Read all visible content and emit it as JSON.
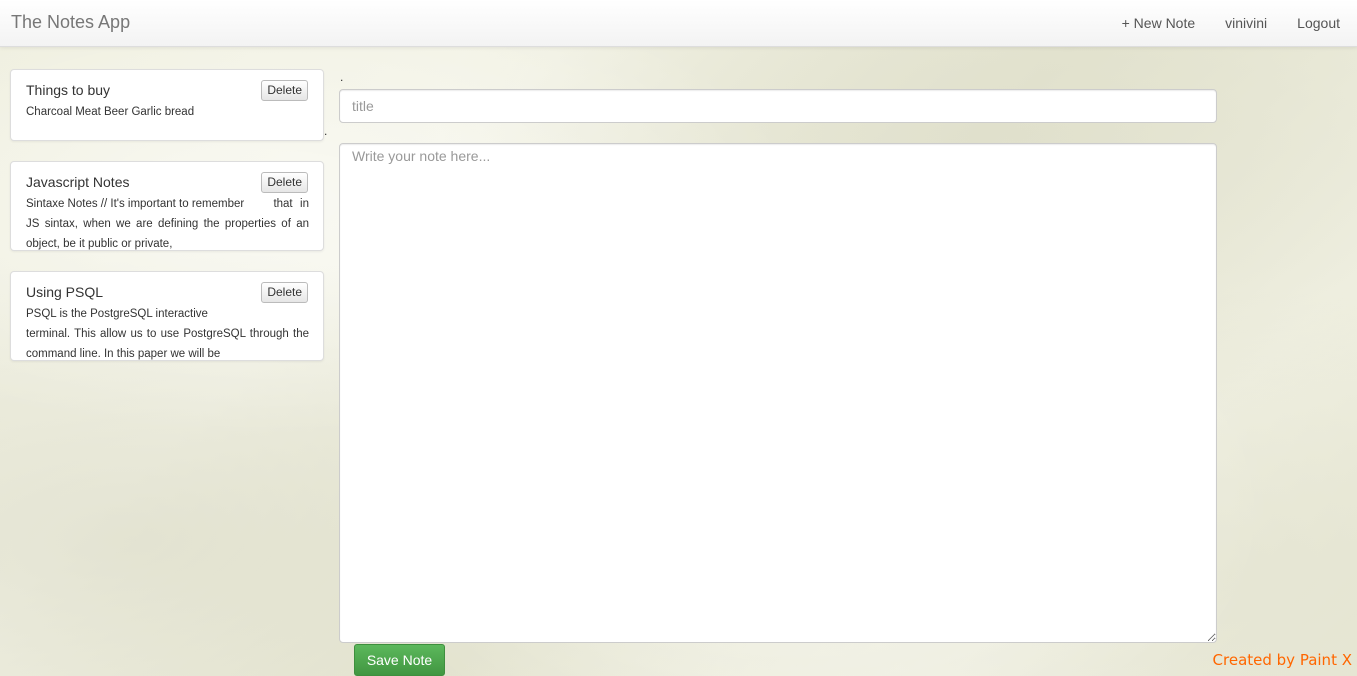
{
  "navbar": {
    "brand": "The Notes App",
    "new_note": "+ New Note",
    "username": "vinivini",
    "logout": "Logout"
  },
  "notes": [
    {
      "title": "Things to buy",
      "body_first": "Charcoal Meat Beer Garlic bread",
      "body_rest": "",
      "delete_label": "Delete"
    },
    {
      "title": "Javascript Notes",
      "body_first": "Sintaxe Notes // It's important to remember",
      "body_rest": "that in JS sintax, when we are defining the properties of an object, be it public or private,",
      "delete_label": "Delete"
    },
    {
      "title": "Using PSQL",
      "body_first": "PSQL is the PostgreSQL interactive",
      "body_rest": "terminal. This allow us to use PostgreSQL through the command line. In this paper we will be",
      "delete_label": "Delete"
    }
  ],
  "editor": {
    "title_placeholder": "title",
    "body_placeholder": "Write your note here...",
    "save_label": "Save Note",
    "dot": "."
  },
  "footer": {
    "credit": "Created by Paint X",
    "credit_color": "#ff6600"
  },
  "colors": {
    "save_button": "#5cb85c",
    "background": "#eeeedd"
  }
}
